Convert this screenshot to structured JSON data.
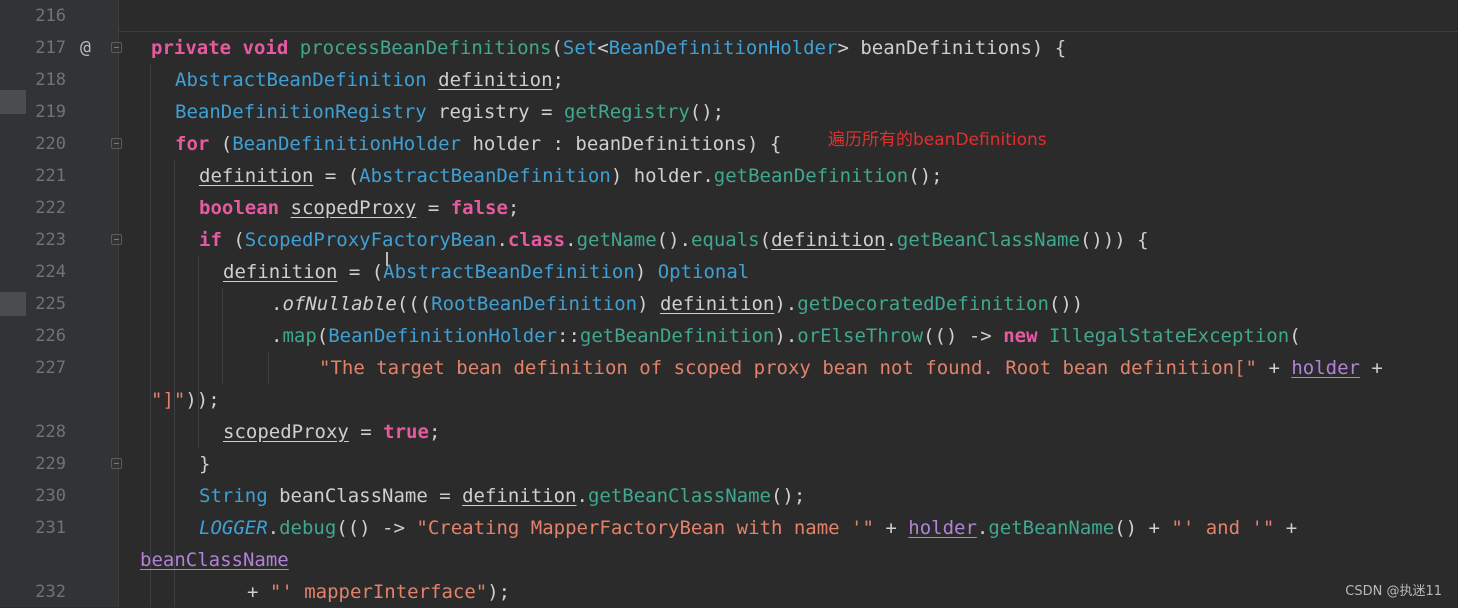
{
  "gutter": {
    "line_numbers": [
      "216",
      "217",
      "218",
      "219",
      "220",
      "221",
      "222",
      "223",
      "224",
      "225",
      "226",
      "227",
      "228",
      "229",
      "230",
      "231",
      "232"
    ],
    "override_marker": "@"
  },
  "code": {
    "l217": {
      "kw1": "private",
      "kw2": "void",
      "fn": "processBeanDefinitions",
      "p1": "(",
      "tp1": "Set",
      "p2": "<",
      "tp2": "BeanDefinitionHolder",
      "p3": "> beanDefinitions) {"
    },
    "l218": {
      "tp": "AbstractBeanDefinition",
      "sp": " ",
      "var": "definition",
      "end": ";"
    },
    "l219": {
      "tp": "BeanDefinitionRegistry",
      "mid": " registry = ",
      "fn": "getRegistry",
      "end": "();"
    },
    "l220": {
      "kw": "for",
      "p1": " (",
      "tp": "BeanDefinitionHolder",
      "end": " holder : beanDefinitions) {"
    },
    "l221": {
      "var": "definition",
      "p1": " = (",
      "tp": "AbstractBeanDefinition",
      "p2": ") holder.",
      "fn": "getBeanDefinition",
      "end": "();"
    },
    "l222": {
      "kw1": "boolean",
      "sp": " ",
      "var": "scopedProxy",
      "p1": " = ",
      "kw2": "false",
      "end": ";"
    },
    "l223": {
      "kw1": "if",
      "p1": " (",
      "tp": "ScopedProxyFactoryBean",
      "p2": ".",
      "kw2": "class",
      "p3": ".",
      "fn1": "getName",
      "p4": "().",
      "fn2": "equals",
      "p5": "(",
      "var": "definition",
      "p6": ".",
      "fn3": "getBeanClassName",
      "end": "())) {"
    },
    "l224": {
      "var": "definition",
      "p1": " = (",
      "tp1": "AbstractBeanDefinition",
      "p2": ") ",
      "tp2": "Optional"
    },
    "l225": {
      "p1": ".",
      "fn1": "ofNullable",
      "p2": "(((",
      "tp": "RootBeanDefinition",
      "p3": ") ",
      "var": "definition",
      "p4": ").",
      "fn2": "getDecoratedDefinition",
      "end": "())"
    },
    "l226": {
      "p1": ".",
      "fn1": "map",
      "p2": "(",
      "tp1": "BeanDefinitionHolder",
      "p3": "::",
      "fn2": "getBeanDefinition",
      "p4": ").",
      "fn3": "orElseThrow",
      "p5": "(() -> ",
      "kw": "new",
      "sp": " ",
      "tp2": "IllegalStateException",
      "end": "("
    },
    "l227": {
      "st": "\"The target bean definition of scoped proxy bean not found. Root bean definition[\"",
      "p1": " + ",
      "var": "holder",
      "end": " +"
    },
    "l227b": {
      "st": "\"]\"",
      "end": "));"
    },
    "l228": {
      "var": "scopedProxy",
      "p1": " = ",
      "kw": "true",
      "end": ";"
    },
    "l229": {
      "text": "}"
    },
    "l230": {
      "tp": "String",
      "p1": " beanClassName = ",
      "var": "definition",
      "p2": ".",
      "fn": "getBeanClassName",
      "end": "();"
    },
    "l231": {
      "logger": "LOGGER",
      "p1": ".",
      "fn1": "debug",
      "p2": "(() -> ",
      "st1": "\"Creating MapperFactoryBean with name '\"",
      "p3": " + ",
      "var": "holder",
      "p4": ".",
      "fn2": "getBeanName",
      "p5": "() + ",
      "st2": "\"' and '\"",
      "end": " +"
    },
    "l231b": {
      "var": "beanClassName"
    },
    "l232": {
      "p1": "+ ",
      "st": "\"' mapperInterface\"",
      "end": ");"
    }
  },
  "annotation": {
    "text": "遍历所有的beanDefinitions",
    "color": "#e0302e"
  },
  "watermark": {
    "text": "CSDN @执迷11"
  },
  "colors": {
    "keyword": "#e75aa0",
    "type": "#3fa0d5",
    "method": "#3fa88e",
    "string": "#e3826a",
    "param": "#b083d8",
    "background": "#2b2b2b"
  }
}
